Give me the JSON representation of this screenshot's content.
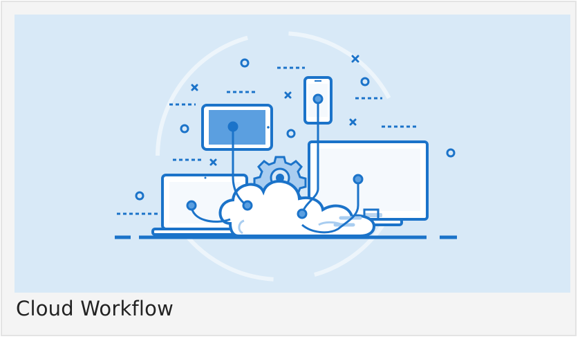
{
  "card": {
    "caption": "Cloud Workflow",
    "illustration_icon": "cloud-workflow-illustration"
  },
  "colors": {
    "background": "#d8e9f7",
    "primary_blue": "#1b73c9",
    "screen_fill": "#f5f9fd",
    "tablet_fill": "#5b9fe0",
    "light_blue": "#a9cdf0",
    "card_bg": "#f4f4f4",
    "text": "#222222"
  }
}
